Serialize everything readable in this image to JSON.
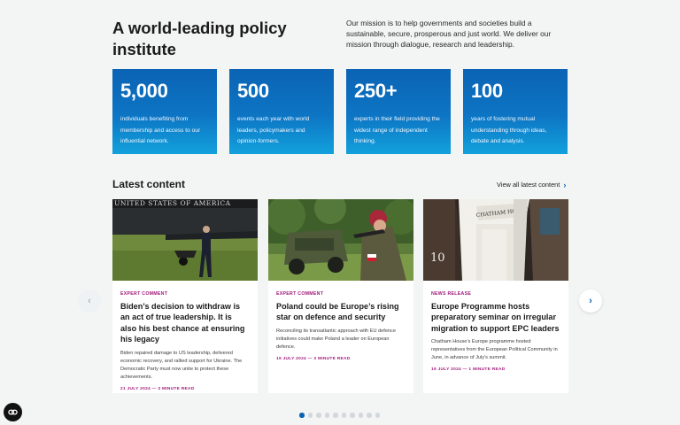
{
  "intro": {
    "headline": "A world-leading policy institute",
    "mission": "Our mission is to help governments and societies build a sustainable, secure, prosperous and just world. We deliver our mission through dialogue, research and leadership."
  },
  "stats": [
    {
      "value": "5,000",
      "description": "individuals benefiting from membership and access to our influential network."
    },
    {
      "value": "500",
      "description": "events each year with world leaders, policymakers and opinion-formers."
    },
    {
      "value": "250+",
      "description": "experts in their field providing the widest range of independent thinking."
    },
    {
      "value": "100",
      "description": "years of fostering mutual understanding through ideas, debate and analysis."
    }
  ],
  "latest": {
    "title": "Latest content",
    "view_all": "View all latest content",
    "cards": [
      {
        "tag": "EXPERT COMMENT",
        "title": "Biden’s decision to withdraw is an act of true leadership. It is also his best chance at ensuring his legacy",
        "summary": "Biden repaired damage to US leadership, delivered economic recovery, and rallied support for Ukraine. The Democratic Party must now unite to protect these achievements.",
        "meta": "21 JULY 2024 — 3 MINUTE READ",
        "image_text": "UNITED STATES OF AMERICA"
      },
      {
        "tag": "EXPERT COMMENT",
        "title": "Poland could be Europe’s rising star on defence and security",
        "summary": "Reconciling its transatlantic approach with EU defence initiatives could make Poland a leader on European defence.",
        "meta": "19 JULY 2024 — 3 MINUTE READ"
      },
      {
        "tag": "NEWS RELEASE",
        "title": "Europe Programme hosts preparatory seminar on irregular migration to support EPC leaders",
        "summary": "Chatham House’s Europe programme hosted representatives from the European Political Community in June, in advance of July’s summit.",
        "meta": "19 JULY 2024 — 1 MINUTE READ",
        "image_text": "CHATHAM HOUSE",
        "image_number": "10"
      }
    ]
  },
  "carousel": {
    "prev_icon": "chevron-left-icon",
    "next_icon": "chevron-right-icon",
    "dot_count": 10,
    "active_dot": 1
  },
  "colors": {
    "brand_blue": "#0b63b4",
    "accent_magenta": "#a0197a",
    "background": "#f3f4f4"
  }
}
